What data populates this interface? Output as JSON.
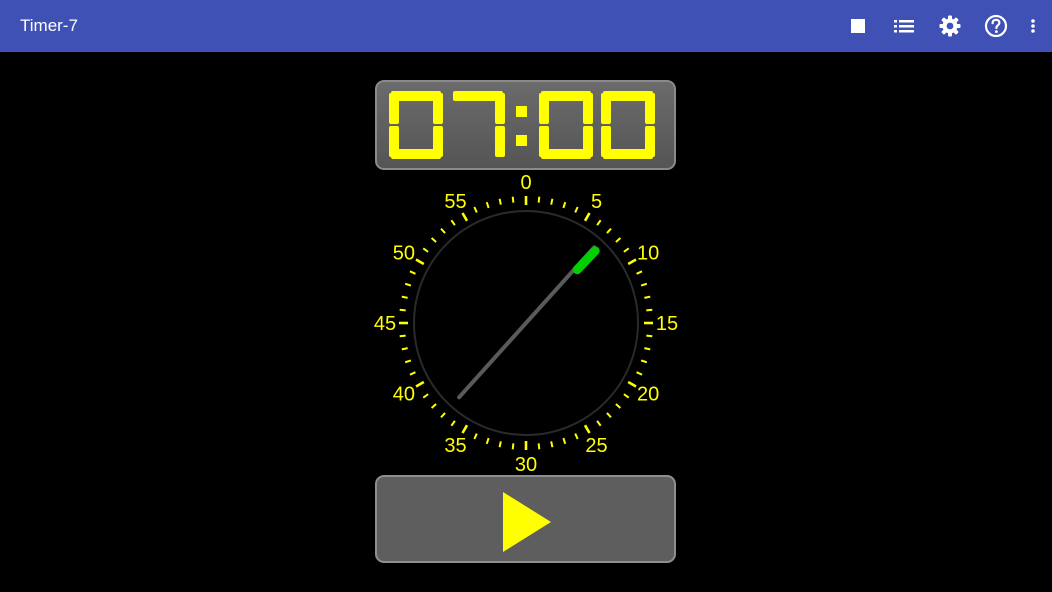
{
  "app": {
    "title": "Timer-7"
  },
  "toolbar": {
    "actions": [
      {
        "name": "stop-icon"
      },
      {
        "name": "list-icon"
      },
      {
        "name": "settings-icon"
      },
      {
        "name": "help-icon"
      },
      {
        "name": "more-vert-icon"
      }
    ]
  },
  "timer": {
    "display": "07:00",
    "set_minutes": 7,
    "dial_labels": [
      "0",
      "5",
      "10",
      "15",
      "20",
      "25",
      "30",
      "35",
      "40",
      "45",
      "50",
      "55"
    ],
    "digit_color": "#ffff00",
    "marker_color": "#00d000"
  },
  "play_button": {
    "icon": "play-icon"
  },
  "colors": {
    "appbar": "#3f51b5",
    "background": "#000000",
    "panel": "#5e5e5e"
  }
}
